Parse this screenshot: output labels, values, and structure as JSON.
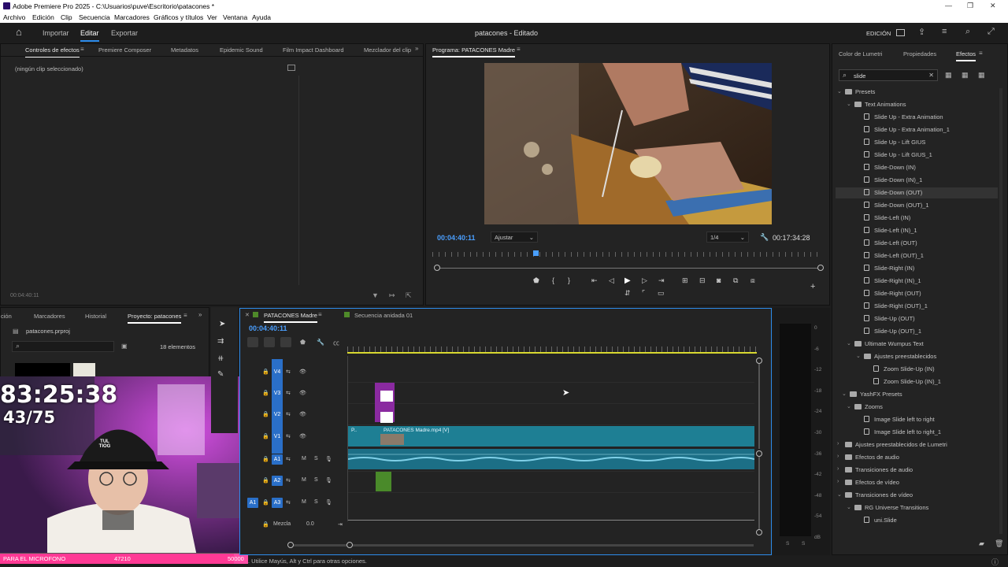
{
  "window": {
    "title": "Adobe Premiere Pro 2025 - C:\\Usuarios\\puve\\Escritorio\\patacones *"
  },
  "menu": [
    "Archivo",
    "Edición",
    "Clip",
    "Secuencia",
    "Marcadores",
    "Gráficos y títulos",
    "Ver",
    "Ventana",
    "Ayuda"
  ],
  "workspace": {
    "tabs": [
      "Importar",
      "Editar",
      "Exportar"
    ],
    "active": "Editar",
    "project_title": "patacones - Editado",
    "mode": "EDICIÓN"
  },
  "effect_controls": {
    "tabs": [
      "Controles de efectos",
      "Premiere Composer",
      "Metadatos",
      "Epidemic Sound",
      "Film Impact Dashboard",
      "Mezclador del clip"
    ],
    "empty_text": "(ningún clip seleccionado)",
    "timecode": "00:04:40:11"
  },
  "program": {
    "title": "Programa: PATACONES Madre",
    "timecode": "00:04:40:11",
    "fit": "Ajustar",
    "resolution": "1/4",
    "duration": "00:17:34:28"
  },
  "right_tabs": [
    "Color de Lumetri",
    "Propiedades",
    "Efectos"
  ],
  "effects": {
    "search": "slide",
    "tree": [
      {
        "label": "Presets",
        "type": "folder",
        "level": 0,
        "open": true
      },
      {
        "label": "Text Animations",
        "type": "folder",
        "level": 1,
        "open": true
      },
      {
        "label": "Slide Up - Extra Animation",
        "type": "preset",
        "level": 2
      },
      {
        "label": "Slide Up - Extra Animation_1",
        "type": "preset",
        "level": 2
      },
      {
        "label": "Slide Up - Lift GIUS",
        "type": "preset",
        "level": 2
      },
      {
        "label": "Slide Up - Lift GIUS_1",
        "type": "preset",
        "level": 2
      },
      {
        "label": "Slide-Down (IN)",
        "type": "preset",
        "level": 2
      },
      {
        "label": "Slide-Down (IN)_1",
        "type": "preset",
        "level": 2
      },
      {
        "label": "Slide-Down (OUT)",
        "type": "preset",
        "level": 2,
        "selected": true
      },
      {
        "label": "Slide-Down (OUT)_1",
        "type": "preset",
        "level": 2
      },
      {
        "label": "Slide-Left (IN)",
        "type": "preset",
        "level": 2
      },
      {
        "label": "Slide-Left (IN)_1",
        "type": "preset",
        "level": 2
      },
      {
        "label": "Slide-Left (OUT)",
        "type": "preset",
        "level": 2
      },
      {
        "label": "Slide-Left (OUT)_1",
        "type": "preset",
        "level": 2
      },
      {
        "label": "Slide-Right (IN)",
        "type": "preset",
        "level": 2
      },
      {
        "label": "Slide-Right (IN)_1",
        "type": "preset",
        "level": 2
      },
      {
        "label": "Slide-Right (OUT)",
        "type": "preset",
        "level": 2
      },
      {
        "label": "Slide-Right (OUT)_1",
        "type": "preset",
        "level": 2
      },
      {
        "label": "Slide-Up (OUT)",
        "type": "preset",
        "level": 2
      },
      {
        "label": "Slide-Up (OUT)_1",
        "type": "preset",
        "level": 2
      },
      {
        "label": "Ultimate Wumpus Text",
        "type": "folder",
        "level": 1,
        "open": true
      },
      {
        "label": "Ajustes preestablecidos",
        "type": "folder",
        "level": 2,
        "open": true
      },
      {
        "label": "Zoom Slide-Up (IN)",
        "type": "preset",
        "level": 3
      },
      {
        "label": "Zoom Slide-Up (IN)_1",
        "type": "preset",
        "level": 3
      },
      {
        "label": "YashFX Presets",
        "type": "folder",
        "level": 0.5,
        "open": true
      },
      {
        "label": "Zooms",
        "type": "folder",
        "level": 1,
        "open": true
      },
      {
        "label": "Image Slide left to right",
        "type": "preset",
        "level": 2
      },
      {
        "label": "Image Slide left to right_1",
        "type": "preset",
        "level": 2
      },
      {
        "label": "Ajustes preestablecidos de Lumetri",
        "type": "folder",
        "level": 0,
        "open": false
      },
      {
        "label": "Efectos de audio",
        "type": "folder",
        "level": 0,
        "open": false
      },
      {
        "label": "Transiciones de audio",
        "type": "folder",
        "level": 0,
        "open": false
      },
      {
        "label": "Efectos de vídeo",
        "type": "folder",
        "level": 0,
        "open": false
      },
      {
        "label": "Transiciones de vídeo",
        "type": "folder",
        "level": 0,
        "open": true
      },
      {
        "label": "RG Universe Transitions",
        "type": "folder",
        "level": 1,
        "open": true
      },
      {
        "label": "uni.Slide",
        "type": "preset",
        "level": 2
      }
    ]
  },
  "project": {
    "tabs": [
      "ción",
      "Marcadores",
      "Historial",
      "Proyecto: patacones"
    ],
    "file": "patacones.prproj",
    "count": "18 elementos"
  },
  "timeline": {
    "tabs": [
      "PATACONES Madre",
      "Secuencia anidada 01"
    ],
    "timecode": "00:04:40:11",
    "video_tracks": [
      "V4",
      "V3",
      "V2",
      "V1"
    ],
    "audio_tracks": [
      "A1",
      "A2",
      "A3"
    ],
    "source_label": "A1",
    "mix_label": "Mezcla",
    "mix_value": "0.0",
    "clip_name": "PATACONES Madre.mp4 [V]",
    "clip_prefix": "P.."
  },
  "meter": {
    "scale": [
      "0",
      "-6",
      "-12",
      "-18",
      "-24",
      "-30",
      "-36",
      "-42",
      "-48",
      "-54",
      "dB"
    ],
    "solo": [
      "S",
      "S"
    ]
  },
  "status": {
    "hint": ". Utilice Mayús, Alt y Ctrl para otras opciones."
  },
  "overlay": {
    "timer": "83:25:38",
    "count": "43/75",
    "banner": "PARA EL MICROFONO",
    "progress_value": "47210",
    "progress_goal": "50000",
    "progress_fraction": 0.944,
    "cap_text": "TUL TIOG"
  }
}
